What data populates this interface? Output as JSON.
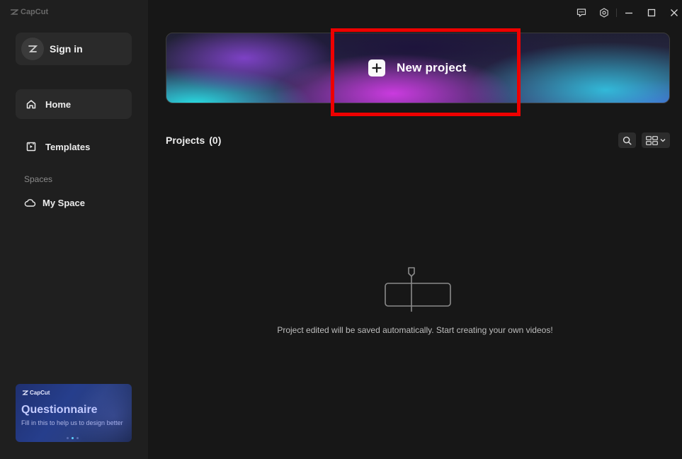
{
  "app": {
    "name": "CapCut"
  },
  "titlebar": {
    "feedback_icon": "feedback-icon",
    "settings_icon": "settings-icon",
    "minimize_icon": "minimize-icon",
    "maximize_icon": "maximize-icon",
    "close_icon": "close-icon"
  },
  "sidebar": {
    "sign_in_label": "Sign in",
    "nav": [
      {
        "label": "Home",
        "icon": "home-icon",
        "active": true
      },
      {
        "label": "Templates",
        "icon": "templates-icon",
        "active": false
      }
    ],
    "spaces_heading": "Spaces",
    "my_space_label": "My Space",
    "promo": {
      "brand": "CapCut",
      "title": "Questionnaire",
      "description": "Fill in this to help us to design better",
      "carousel_active_index": 1,
      "carousel_count": 3
    }
  },
  "banner": {
    "label": "New project",
    "icon": "plus-icon"
  },
  "projects": {
    "heading": "Projects",
    "count_text": "(0)"
  },
  "empty_state": {
    "message": "Project edited will be saved automatically. Start creating your own videos!"
  },
  "colors": {
    "sidebar_bg": "#1f1f1f",
    "main_bg": "#171717",
    "highlight": "#ee0000"
  }
}
